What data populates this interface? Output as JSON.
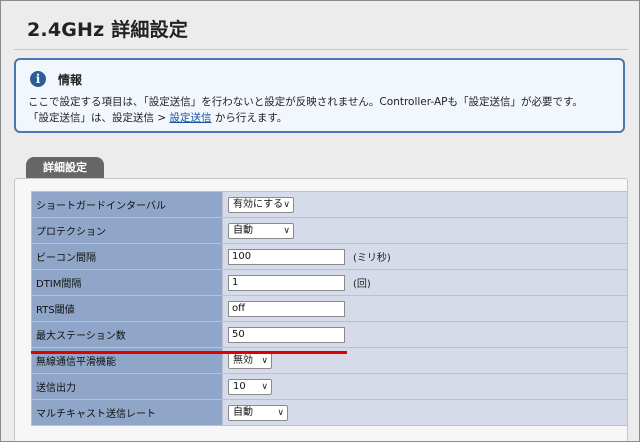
{
  "page": {
    "title": "2.4GHz 詳細設定"
  },
  "info": {
    "icon": "info-icon",
    "heading": "情報",
    "line1": "ここで設定する項目は、「設定送信」を行わないと設定が反映されません。Controller-APも「設定送信」が必要です。",
    "line2_prefix": "「設定送信」は、設定送信 > ",
    "line2_link": "設定送信",
    "line2_suffix": " から行えます。"
  },
  "tab": {
    "label": "詳細設定"
  },
  "settings": {
    "rows": [
      {
        "label": "ショートガードインターバル",
        "value": "有効にする"
      },
      {
        "label": "プロテクション",
        "value": "自動"
      },
      {
        "label": "ビーコン間隔",
        "value": "100",
        "unit": "(ミリ秒)"
      },
      {
        "label": "DTIM間隔",
        "value": "1",
        "unit": "(回)"
      },
      {
        "label": "RTS閾値",
        "value": "off"
      },
      {
        "label": "最大ステーション数",
        "value": "50"
      },
      {
        "label": "無線通信平滑機能",
        "value": "無効"
      },
      {
        "label": "送信出力",
        "value": "10"
      },
      {
        "label": "マルチキャスト送信レート",
        "value": "自動"
      }
    ]
  },
  "colors": {
    "label_bg": "#8fa6c8",
    "value_bg": "#d6dbea",
    "info_border": "#4a76b5",
    "highlight": "#e00000"
  }
}
